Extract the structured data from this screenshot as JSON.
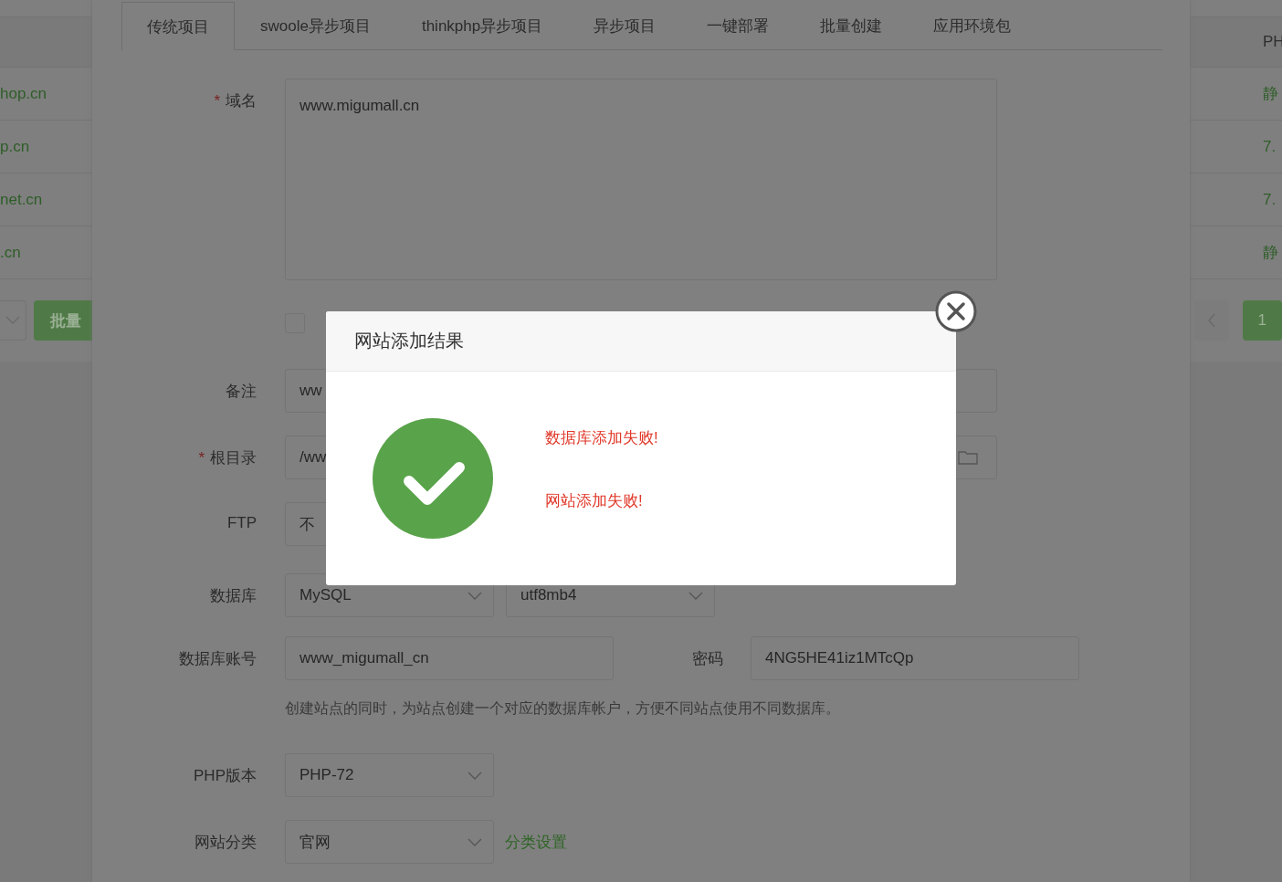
{
  "background_table": {
    "left_cells": [
      "hop.cn",
      "p.cn",
      "net.cn",
      ".cn"
    ],
    "left_batch_button": "批量",
    "right_header": "PH",
    "right_cells": [
      "静",
      "7.",
      "7.",
      "静"
    ],
    "pagination": [
      {
        "label": "1",
        "selected": true
      }
    ]
  },
  "tabs": [
    {
      "label": "传统项目",
      "selected": true
    },
    {
      "label": "swoole异步项目",
      "selected": false
    },
    {
      "label": "thinkphp异步项目",
      "selected": false
    },
    {
      "label": "异步项目",
      "selected": false
    },
    {
      "label": "一键部署",
      "selected": false
    },
    {
      "label": "批量创建",
      "selected": false
    },
    {
      "label": "应用环境包",
      "selected": false
    }
  ],
  "form": {
    "domain": {
      "label": "域名",
      "required_mark": "*",
      "value": "www.migumall.cn"
    },
    "checkbox": {
      "checked": false
    },
    "remark": {
      "label": "备注",
      "value": "ww"
    },
    "root": {
      "label": "根目录",
      "required_mark": "*",
      "value": "/ww"
    },
    "ftp": {
      "label": "FTP",
      "value": "不"
    },
    "database": {
      "label": "数据库",
      "type": "MySQL",
      "charset": "utf8mb4"
    },
    "db_account": {
      "label": "数据库账号",
      "value": "www_migumall_cn",
      "password_label": "密码",
      "password": "4NG5HE41iz1MTcQp"
    },
    "hint": "创建站点的同时，为站点创建一个对应的数据库帐户，方便不同站点使用不同数据库。",
    "php": {
      "label": "PHP版本",
      "value": "PHP-72"
    },
    "category": {
      "label": "网站分类",
      "value": "官网",
      "link": "分类设置"
    }
  },
  "modal": {
    "title": "网站添加结果",
    "success": true,
    "messages": [
      "数据库添加失败!",
      "网站添加失败!"
    ]
  }
}
